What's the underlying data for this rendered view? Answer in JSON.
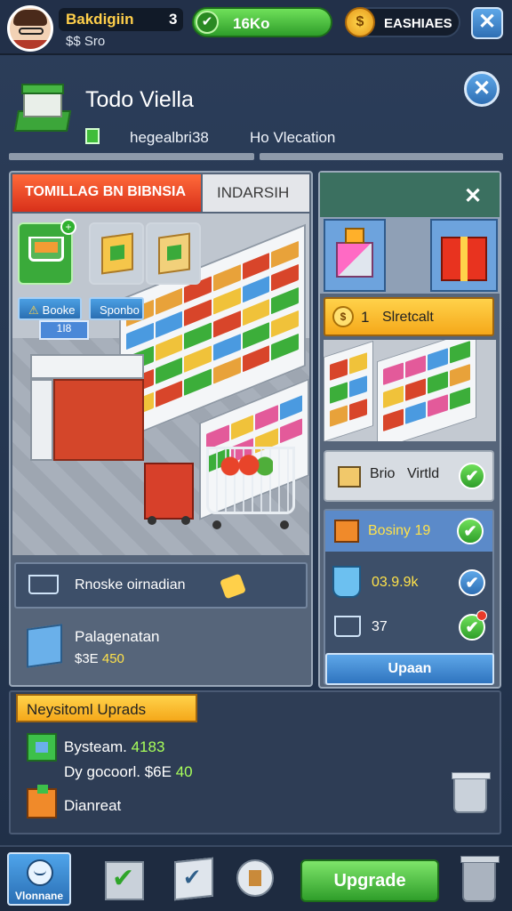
{
  "hud": {
    "player_name": "Bakdigiin",
    "player_level": "3",
    "player_sub": "$$ Sro",
    "green_pill_text": "16Ko",
    "coin_label": "EASHIAES",
    "close_glyph": "✕"
  },
  "store": {
    "title": "Todo Viella",
    "info_left": "hegealbri38",
    "info_right": "Ho Vlecation",
    "close_glyph": "✕"
  },
  "tabs": {
    "active": "TOMILLAG BN BIBNSIA",
    "inactive": "INDARSIH"
  },
  "left_panel": {
    "books_button": "Booke",
    "sponsors_button": "Sponbo",
    "scene_sign": "1I8",
    "strip_text": "Rnoske oirnadian",
    "package_title": "Palagenatan",
    "package_price_prefix": "$3E",
    "package_price_value": "450"
  },
  "right_panel": {
    "close_glyph": "✕",
    "yellow_number": "1",
    "yellow_text": "Slretcalt",
    "card_text_1": "Brio",
    "card_text_2": "Virtld",
    "item1_text": "Bosiny 19",
    "item2_value": "03.9.9k",
    "item3_value": "37",
    "upgrade_button": "Upaan"
  },
  "bottom_section": {
    "label": "Neysitoml Uprads",
    "line1_text": "Bysteam.",
    "line1_value": "4183",
    "line2_text": "Dy gocoorl. $6E",
    "line2_value": "40",
    "line3_text": "Dianreat"
  },
  "footer": {
    "home_label": "Vlonnane",
    "upgrade_button": "Upgrade"
  },
  "colors": {
    "accent_green": "#2f9e2a",
    "accent_blue": "#2f6fb4",
    "accent_yellow": "#f5a81a",
    "tab_red": "#d8301a"
  }
}
